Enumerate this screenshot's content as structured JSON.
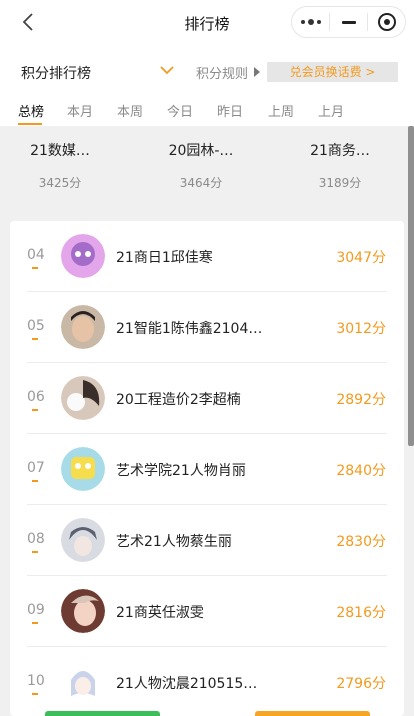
{
  "nav": {
    "title": "排行榜"
  },
  "filter": {
    "label": "积分排行榜",
    "rules": "积分规则",
    "exchange": "兑会员换话费 >"
  },
  "tabs": [
    "总榜",
    "本月",
    "本周",
    "今日",
    "昨日",
    "上周",
    "上月"
  ],
  "top3": [
    {
      "name": "21数媒…",
      "score": "3425分"
    },
    {
      "name": "20园林-…",
      "score": "3464分"
    },
    {
      "name": "21商务…",
      "score": "3189分"
    }
  ],
  "list": [
    {
      "rank": "04",
      "name": "21商日1邱佳寒",
      "score": "3047分",
      "avatar_color": "#c56fd1"
    },
    {
      "rank": "05",
      "name": "21智能1陈伟鑫2104…",
      "score": "3012分",
      "avatar_color": "#6b5a4e"
    },
    {
      "rank": "06",
      "name": "20工程造价2李超楠",
      "score": "2892分",
      "avatar_color": "#b49a8a"
    },
    {
      "rank": "07",
      "name": "艺术学院21人物肖丽",
      "score": "2840分",
      "avatar_color": "#f2d25a"
    },
    {
      "rank": "08",
      "name": "艺术21人物蔡生丽",
      "score": "2830分",
      "avatar_color": "#8b8fa0"
    },
    {
      "rank": "09",
      "name": "21商英任淑雯",
      "score": "2816分",
      "avatar_color": "#d9a17c"
    },
    {
      "rank": "10",
      "name": "21人物沈晨210515…",
      "score": "2796分",
      "avatar_color": "#cfd6e8"
    }
  ],
  "colors": {
    "accent": "#f39a1e"
  }
}
